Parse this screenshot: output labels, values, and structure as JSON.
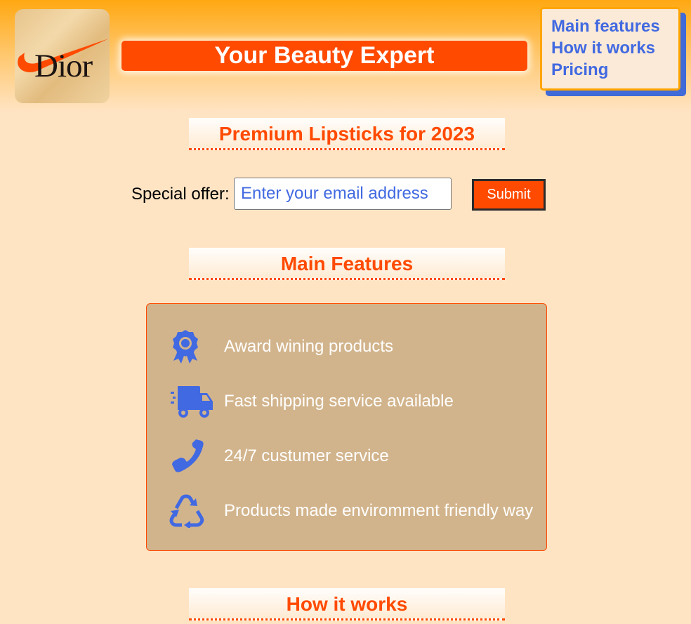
{
  "header": {
    "logo_text": "Dior",
    "title": "Your Beauty Expert"
  },
  "nav": {
    "items": [
      {
        "label": "Main features"
      },
      {
        "label": "How it works"
      },
      {
        "label": "Pricing"
      }
    ]
  },
  "sections": {
    "lipsticks_heading": "Premium Lipsticks for 2023",
    "features_heading": "Main Features",
    "how_heading": "How it works"
  },
  "offer": {
    "label": "Special offer:",
    "email_placeholder": "Enter your email address",
    "submit_label": "Submit"
  },
  "features": [
    {
      "icon": "award-icon",
      "text": "Award wining products"
    },
    {
      "icon": "shipping-truck-icon",
      "text": "Fast shipping service available"
    },
    {
      "icon": "phone-icon",
      "text": "24/7 custumer service"
    },
    {
      "icon": "recycle-icon",
      "text": "Products made enviromment friendly way"
    }
  ],
  "colors": {
    "accent": "#ff4a00",
    "link": "#4169e1",
    "background": "#ffe4c4",
    "features_box": "#d2b48c"
  }
}
